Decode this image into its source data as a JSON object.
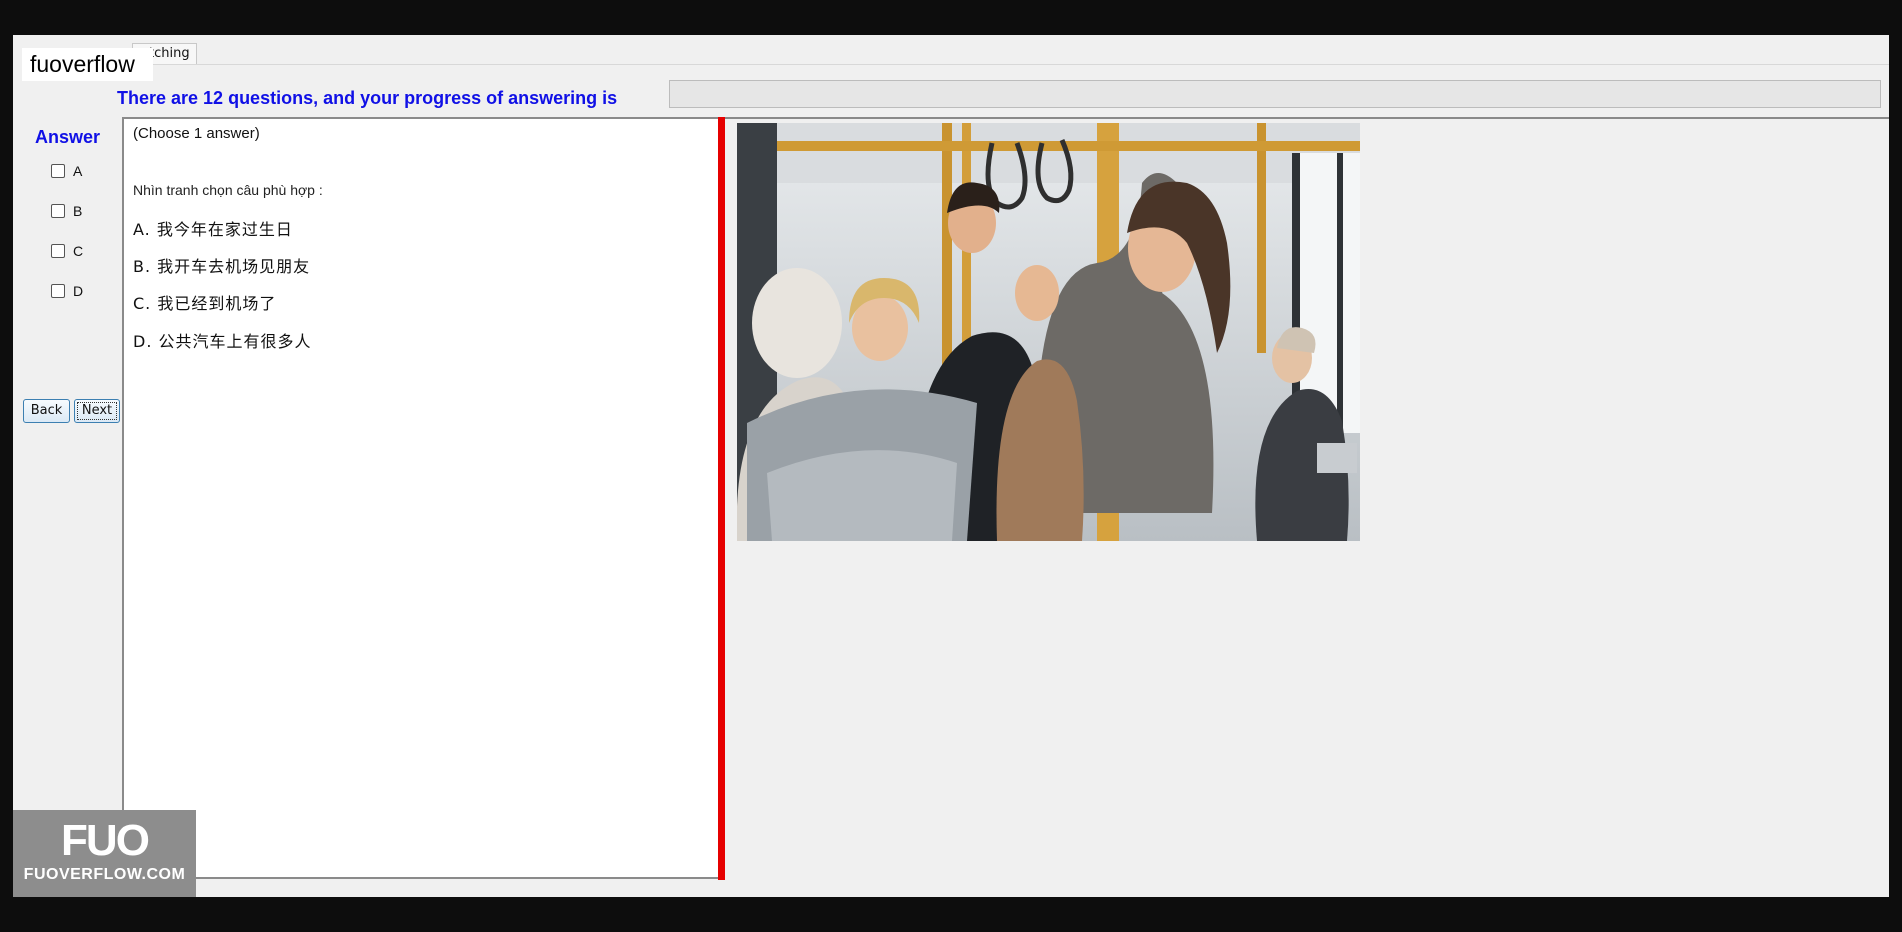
{
  "window": {
    "tab_label": "tching",
    "watermark_top": "fuoverflow"
  },
  "progress": {
    "label": "There are 12 questions, and your progress of answering is",
    "value": 0
  },
  "answer_panel": {
    "title": "Answer",
    "options": [
      "A",
      "B",
      "C",
      "D"
    ]
  },
  "navigation": {
    "back_label": "Back",
    "next_label": "Next"
  },
  "question": {
    "hint": "(Choose 1 answer)",
    "instruction": "Nhìn tranh chọn câu phù hợp :",
    "choices": [
      "A.  我今年在家过生日",
      "B.  我开车去机场见朋友",
      "C.  我已经到机场了",
      "D.  公共汽车上有很多人"
    ]
  },
  "logo": {
    "mark": "FUO",
    "text": "FUOVERFLOW.COM"
  },
  "colors": {
    "accent_blue": "#1010e6",
    "splitter_red": "#e60000"
  }
}
